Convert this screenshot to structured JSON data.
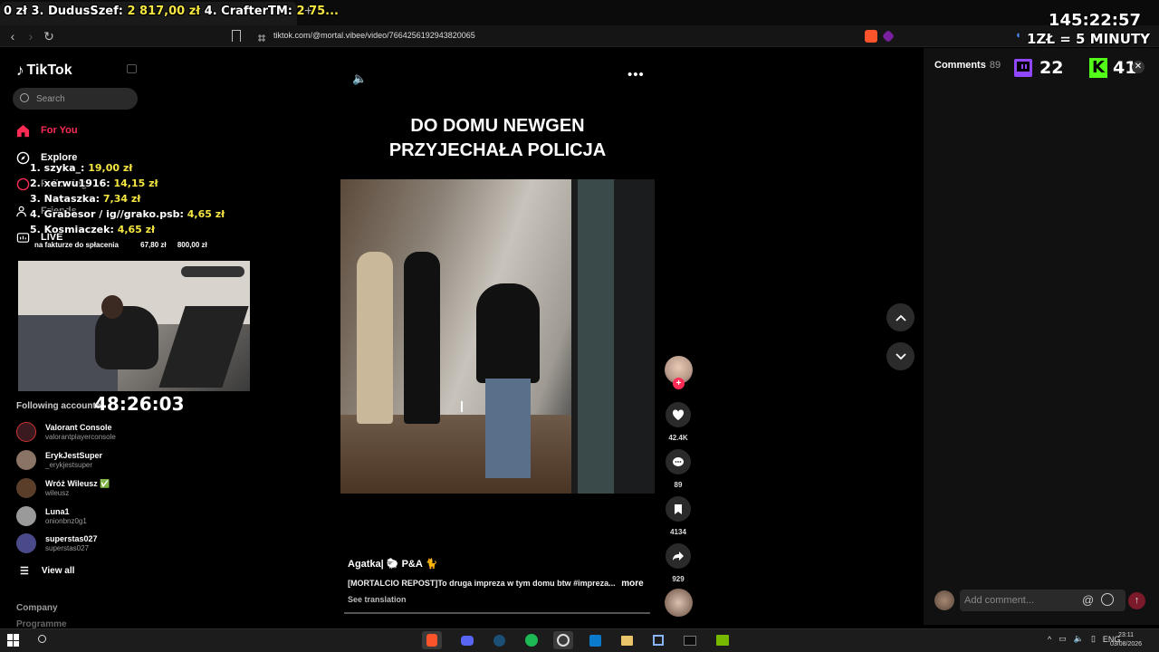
{
  "browser": {
    "new_tab_label": "+",
    "url": "tiktok.com/@mortal.vibee/video/7664256192943820065"
  },
  "overlay": {
    "ticker": [
      {
        "text": "0 zł 3. DudusSzef: ",
        "amount": "2 817,00 zł"
      },
      {
        "text": " 4. CrafterTM: ",
        "amount": "2 75..."
      }
    ],
    "countdown": "145:22:57",
    "rate": "1ZŁ = 5 MINUTY",
    "donors": [
      {
        "name": "1. szyka_: ",
        "amount": "19,00 zł"
      },
      {
        "name": "2. xerwu1916: ",
        "amount": "14,15 zł"
      },
      {
        "name": "3. Nataszka: ",
        "amount": "7,34 zł"
      },
      {
        "name": "4. Grabesor / ig//grako.psb: ",
        "amount": "4,65 zł"
      },
      {
        "name": "5. Kosmiaczek: ",
        "amount": "4,65 zł"
      }
    ],
    "invoice_label": "na fakturze do spłacenia",
    "invoice_amount": "67,80 zł",
    "invoice_total": "800,00 zł",
    "timer": "48:26:03"
  },
  "sidebar": {
    "logo": "TikTok",
    "search_placeholder": "Search",
    "nav": {
      "for_you": "For You",
      "explore": "Explore",
      "following": "Following",
      "friends": "Friends",
      "live": "LIVE"
    },
    "following_title": "Following accounts",
    "accounts": [
      {
        "name": "Valorant Console",
        "handle": "valorantplayerconsole",
        "color": "#3a1a1f"
      },
      {
        "name": "ErykJestSuper",
        "handle": "_erykjestsuper",
        "color": "#8a7466"
      },
      {
        "name": "Wróż Wileusz ✅",
        "handle": "wileusz",
        "color": "#5a3e2a"
      },
      {
        "name": "Luna1",
        "handle": "onionbnz0g1",
        "color": "#9a9a9a"
      },
      {
        "name": "superstas027",
        "handle": "superstas027",
        "color": "#4a4a8a"
      }
    ],
    "view_all": "View all",
    "company": "Company",
    "programme": "Programme"
  },
  "video": {
    "caption_line1": "DO DOMU NEWGEN",
    "caption_line2": "PRZYJECHAŁA POLICJA",
    "author": "Agatka| 🐑 P&A 🐈",
    "description": "[MORTALCIO REPOST]To druga impreza w tym domu btw #impreza...",
    "more": "more",
    "see_translation": "See translation",
    "likes": "42.4K",
    "comments": "89",
    "saves": "4134",
    "shares": "929"
  },
  "comments_panel": {
    "title": "Comments",
    "count": "89",
    "twitch_viewers": "22",
    "kick_viewers": "41",
    "input_placeholder": "Add comment..."
  },
  "taskbar": {
    "language": "ENG",
    "time": "23:11",
    "date": "03/08/2026"
  }
}
